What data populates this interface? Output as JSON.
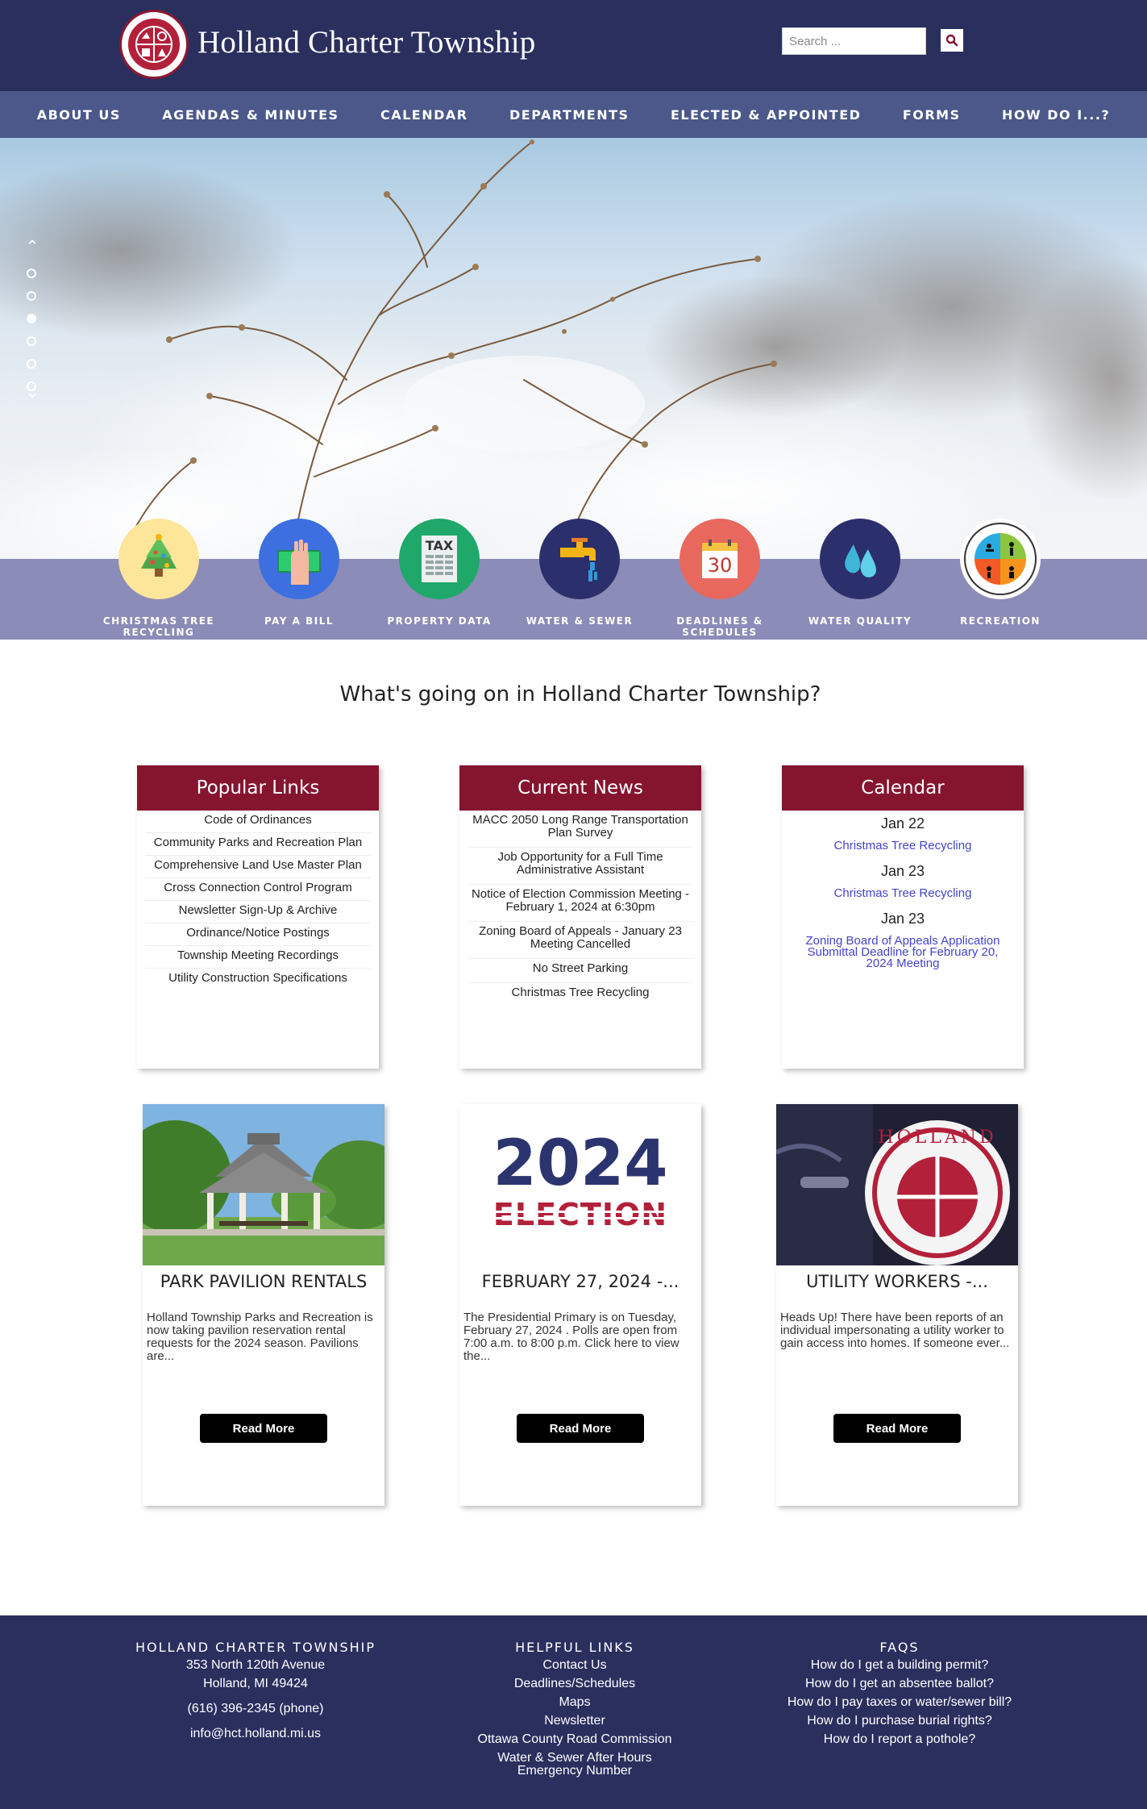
{
  "header": {
    "site_title": "Holland Charter Township",
    "search_placeholder": "Search ...",
    "colors": {
      "header_bg": "#2a2f5e",
      "nav_bg": "#4b5889",
      "accent": "#85142f"
    }
  },
  "nav": {
    "items": [
      {
        "label": "ABOUT US"
      },
      {
        "label": "AGENDAS & MINUTES"
      },
      {
        "label": "CALENDAR"
      },
      {
        "label": "DEPARTMENTS"
      },
      {
        "label": "ELECTED & APPOINTED"
      },
      {
        "label": "FORMS"
      },
      {
        "label": "HOW DO I...?"
      }
    ]
  },
  "slider": {
    "slide_count": 6,
    "active_index": 3
  },
  "quick_links": [
    {
      "label": "CHRISTMAS TREE RECYCLING",
      "icon": "christmas-tree-icon",
      "color": "#fde59a"
    },
    {
      "label": "PAY A BILL",
      "icon": "money-hand-icon",
      "color": "#3d6fe0"
    },
    {
      "label": "PROPERTY DATA",
      "icon": "tax-document-icon",
      "color": "#1fa86a"
    },
    {
      "label": "WATER & SEWER",
      "icon": "faucet-icon",
      "color": "#2b2f6b"
    },
    {
      "label": "DEADLINES & SCHEDULES",
      "icon": "calendar-30-icon",
      "color": "#e8685e",
      "number": "30"
    },
    {
      "label": "WATER QUALITY",
      "icon": "water-drops-icon",
      "color": "#2b2f6b"
    },
    {
      "label": "RECREATION",
      "icon": "recreation-seal-icon",
      "color": "#ffffff"
    }
  ],
  "section_heading": "What's going on in Holland Charter Township?",
  "popular_links": {
    "title": "Popular Links",
    "items": [
      "Code of Ordinances",
      "Community Parks and Recreation Plan",
      "Comprehensive Land Use Master Plan",
      "Cross Connection Control Program",
      "Newsletter Sign-Up & Archive",
      "Ordinance/Notice Postings",
      "Township Meeting Recordings",
      "Utility Construction Specifications"
    ]
  },
  "current_news": {
    "title": "Current News",
    "items": [
      "MACC 2050 Long Range Transportation Plan Survey",
      "Job Opportunity for a Full Time Administrative Assistant",
      "Notice of Election Commission Meeting - February 1, 2024 at 6:30pm",
      "Zoning Board of Appeals - January 23 Meeting Cancelled",
      "No Street Parking",
      "Christmas Tree Recycling"
    ]
  },
  "calendar": {
    "title": "Calendar",
    "events": [
      {
        "date": "Jan 22",
        "title": "Christmas Tree Recycling"
      },
      {
        "date": "Jan 23",
        "title": "Christmas Tree Recycling"
      },
      {
        "date": "Jan 23",
        "title": "Zoning Board of Appeals Application Submittal Deadline for February 20, 2024 Meeting"
      }
    ]
  },
  "features": [
    {
      "title": "PARK PAVILION RENTALS",
      "excerpt": "Holland Township Parks and Recreation is now taking pavilion reservation rental requests for the 2024 season. Pavilions are...",
      "button": "Read More"
    },
    {
      "title": "FEBRUARY 27, 2024 -...",
      "excerpt": "The Presidential Primary is on Tuesday, February 27, 2024 . Polls are open from 7:00 a.m. to 8:00 p.m. Click here to view the...",
      "button": "Read More",
      "image_text": {
        "year": "2024",
        "word": "ELECTION"
      }
    },
    {
      "title": "UTILITY WORKERS -...",
      "excerpt": "Heads Up! There have been reports of an individual impersonating a utility worker to gain access into homes. If someone ever...",
      "button": "Read More",
      "image_text": {
        "seal_top": "HOLLAND"
      }
    }
  ],
  "footer": {
    "address": {
      "heading": "HOLLAND CHARTER TOWNSHIP",
      "street": "353 North 120th Avenue",
      "city": "Holland, MI 49424",
      "phone": "(616) 396-2345 (phone)",
      "email": "info@hct.holland.mi.us"
    },
    "helpful_links": {
      "heading": "HELPFUL LINKS",
      "items": [
        "Contact Us",
        "Deadlines/Schedules",
        "Maps",
        "Newsletter",
        "Ottawa County Road Commission",
        "Water & Sewer After Hours Emergency Number"
      ]
    },
    "faqs": {
      "heading": "FAQS",
      "items": [
        "How do I get a building permit?",
        "How do I get an absentee ballot?",
        "How do I pay taxes or water/sewer bill?",
        "How do I purchase burial rights?",
        "How do I report a pothole?"
      ]
    }
  }
}
